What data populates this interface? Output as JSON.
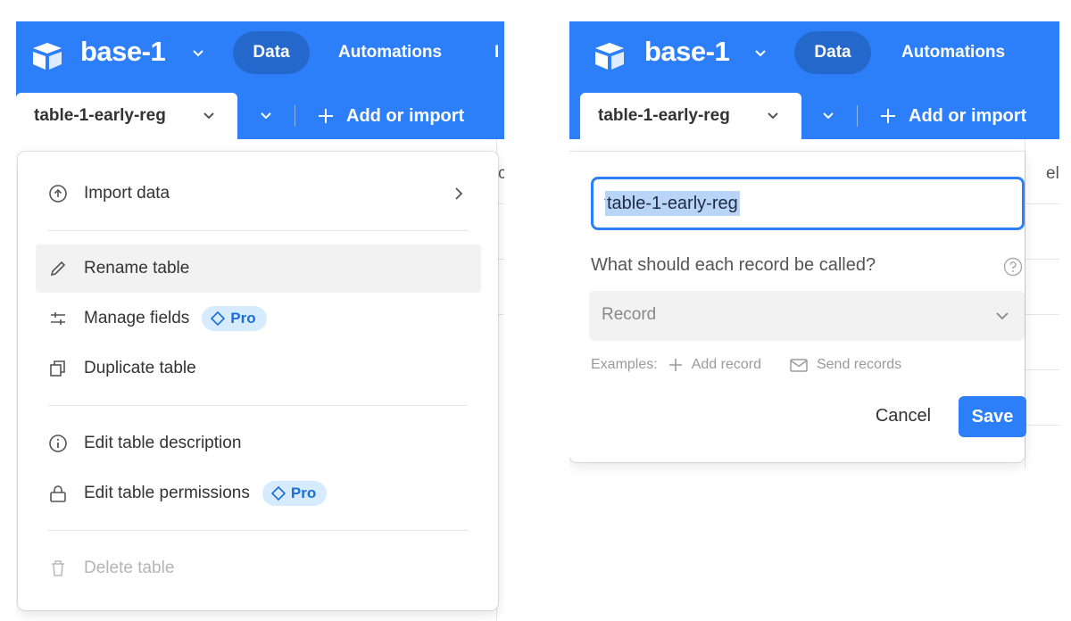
{
  "left_panel": {
    "app": {
      "base_name": "base-1",
      "nav": {
        "data_tab": "Data",
        "automations_tab": "Automations",
        "cut_tab": "I"
      }
    },
    "tabs": {
      "table_name": "table-1-early-reg",
      "add_import": "Add or import"
    },
    "menu": {
      "import_data": "Import data",
      "rename_table": "Rename table",
      "manage_fields": "Manage fields",
      "duplicate_table": "Duplicate table",
      "edit_description": "Edit table description",
      "edit_permissions": "Edit table permissions",
      "delete_table": "Delete table",
      "pro_badge": "Pro"
    },
    "peek_char": "c"
  },
  "right_panel": {
    "app": {
      "base_name": "base-1",
      "nav": {
        "data_tab": "Data",
        "automations_tab": "Automations"
      }
    },
    "tabs": {
      "table_name": "table-1-early-reg",
      "add_import": "Add or import"
    },
    "rename": {
      "input_value": "table-1-early-reg",
      "record_question": "What should each record be called?",
      "record_select_value": "Record",
      "examples_label": "Examples:",
      "example_add": "Add record",
      "example_send": "Send records",
      "cancel_label": "Cancel",
      "save_label": "Save"
    },
    "peek_char": "el"
  },
  "colors": {
    "brand_blue": "#2d7ff9",
    "pro_bg": "#d7ebff",
    "pro_text": "#1a6fd6"
  }
}
